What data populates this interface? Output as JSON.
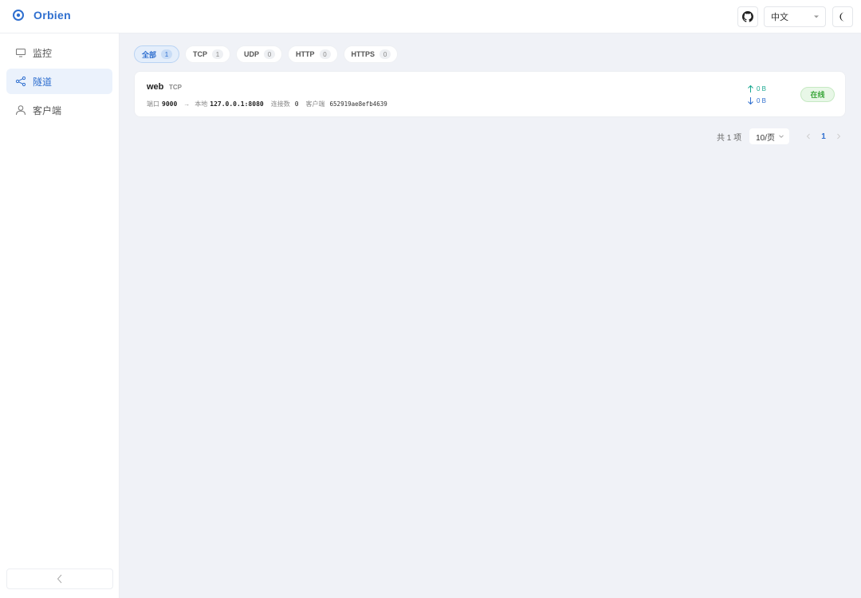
{
  "app": {
    "name": "Orbien"
  },
  "header": {
    "language": "中文"
  },
  "sidebar": {
    "items": [
      {
        "label": "监控",
        "icon": "monitor-icon",
        "active": false
      },
      {
        "label": "隧道",
        "icon": "share-icon",
        "active": true
      },
      {
        "label": "客户端",
        "icon": "user-icon",
        "active": false
      }
    ]
  },
  "filters": [
    {
      "label": "全部",
      "count": "1",
      "active": true
    },
    {
      "label": "TCP",
      "count": "1",
      "active": false
    },
    {
      "label": "UDP",
      "count": "0",
      "active": false
    },
    {
      "label": "HTTP",
      "count": "0",
      "active": false
    },
    {
      "label": "HTTPS",
      "count": "0",
      "active": false
    }
  ],
  "tunnel": {
    "name": "web",
    "protocol": "TCP",
    "port_label": "端口",
    "port": "9000",
    "local_label": "本地",
    "local_addr": "127.0.0.1:8080",
    "connections_label": "连接数",
    "connections": "0",
    "client_label": "客户端",
    "client_id": "652919ae8efb4639",
    "upload": "0 B",
    "download": "0 B",
    "status": "在线"
  },
  "pagination": {
    "total": "共 1 项",
    "page_size": "10/页",
    "current_page": "1"
  },
  "colors": {
    "accent": "#2f6fcf",
    "online": "#3aa63a",
    "upload": "#1aa890",
    "background": "#f0f2f7"
  }
}
